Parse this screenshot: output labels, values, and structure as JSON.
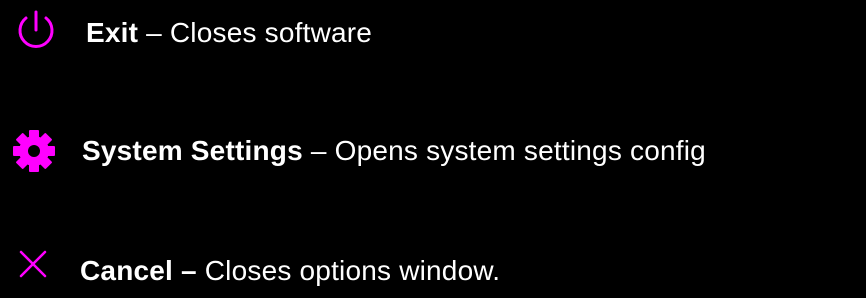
{
  "accent_color": "#ff00ff",
  "background_color": "#000000",
  "text_color": "#ffffff",
  "items": [
    {
      "icon": "power-icon",
      "label": "Exit",
      "description": " – Closes software"
    },
    {
      "icon": "gear-icon",
      "label": "System Settings",
      "description": " – Opens system settings config"
    },
    {
      "icon": "close-icon",
      "label": "Cancel –",
      "description": " Closes options window."
    }
  ]
}
